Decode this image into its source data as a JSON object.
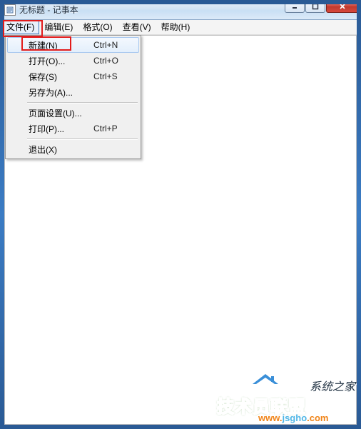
{
  "window": {
    "title": "无标题 - 记事本"
  },
  "menubar": {
    "file": "文件(F)",
    "edit": "编辑(E)",
    "format": "格式(O)",
    "view": "查看(V)",
    "help": "帮助(H)"
  },
  "file_menu": {
    "new": {
      "label": "新建(N)",
      "shortcut": "Ctrl+N"
    },
    "open": {
      "label": "打开(O)...",
      "shortcut": "Ctrl+O"
    },
    "save": {
      "label": "保存(S)",
      "shortcut": "Ctrl+S"
    },
    "save_as": {
      "label": "另存为(A)...",
      "shortcut": ""
    },
    "page_setup": {
      "label": "页面设置(U)...",
      "shortcut": ""
    },
    "print": {
      "label": "打印(P)...",
      "shortcut": "Ctrl+P"
    },
    "exit": {
      "label": "退出(X)",
      "shortcut": ""
    }
  },
  "watermark": {
    "top_text": "系统之家",
    "main_text": "技术员联盟",
    "url_a": "www.",
    "url_b": "jsgho",
    "url_c": ".com"
  }
}
